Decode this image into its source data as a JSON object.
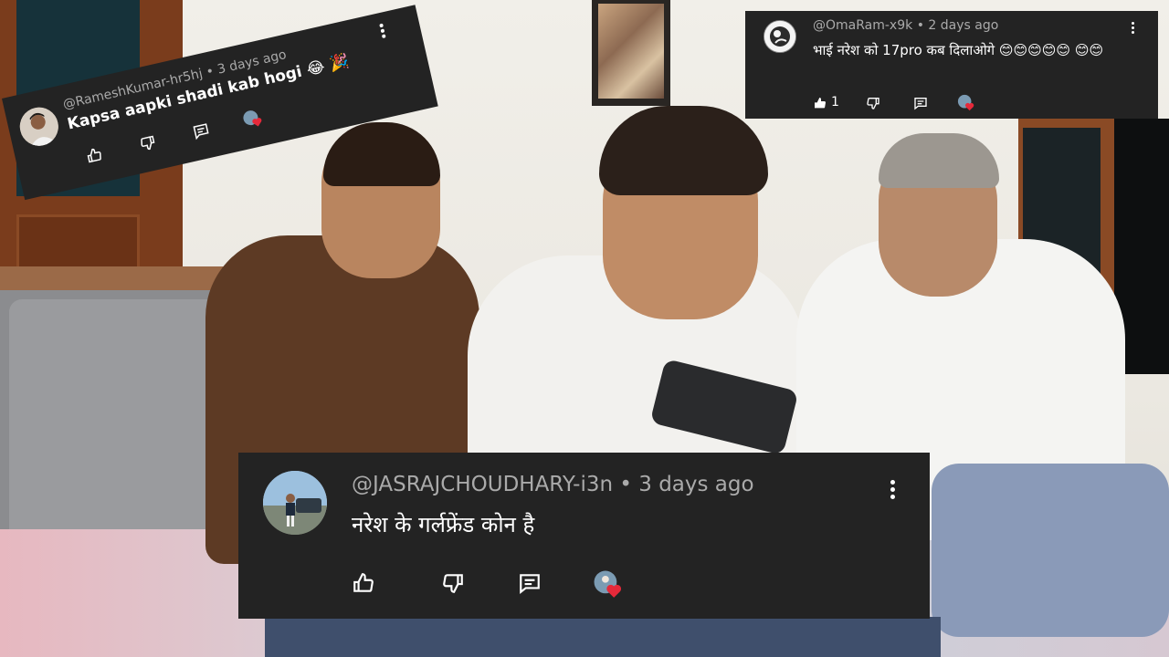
{
  "comments": [
    {
      "handle": "@RameshKumar-hr5hj",
      "time": "3 days ago",
      "text": "Kapsa aapki shadi kab hogi 😂 🎉",
      "likes": ""
    },
    {
      "handle": "@OmaRam-x9k",
      "time": "2 days ago",
      "text": "भाई नरेश को 17pro कब दिलाओगे 😊😊😊😊😊 😊😊",
      "likes": "1"
    },
    {
      "handle": "@JASRAJCHOUDHARY-i3n",
      "time": "3 days ago",
      "text": "नरेश के गर्लफ्रेंड कोन है",
      "likes": ""
    }
  ],
  "separator": "•",
  "icons": {
    "like": "thumbs-up-icon",
    "dislike": "thumbs-down-icon",
    "reply": "reply-icon",
    "creator_heart": "creator-heart-icon",
    "more": "more-vertical-icon"
  },
  "colors": {
    "card_bg": "#232323",
    "handle": "#aaaaaa",
    "heart": "#e5293a"
  }
}
